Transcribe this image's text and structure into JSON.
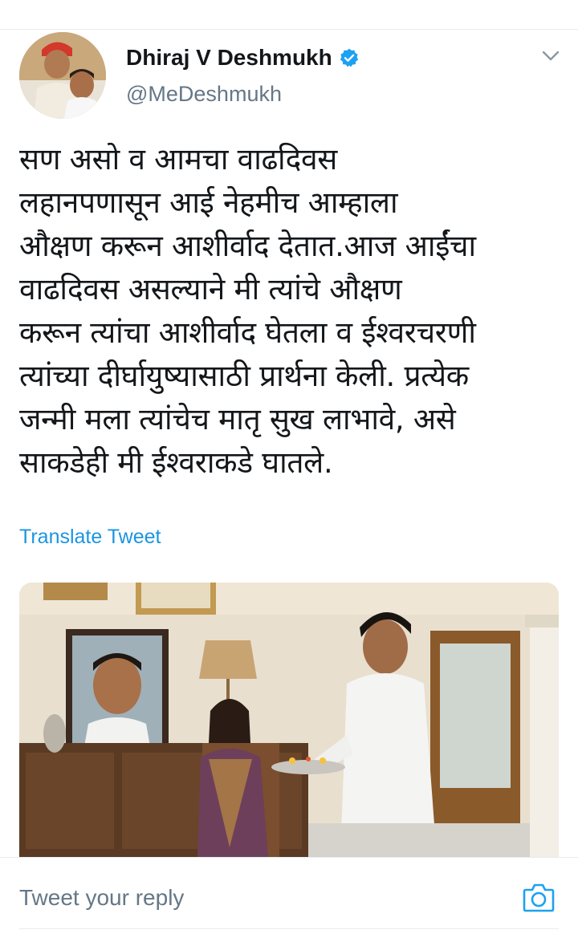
{
  "tweet": {
    "author": {
      "display_name": "Dhiraj V Deshmukh",
      "handle": "@MeDeshmukh",
      "verified": true
    },
    "text": "सण असो व आमचा वाढदिवस\nलहानपणासून आई नेहमीच आम्हाला\nऔक्षण करून आशीर्वाद देतात.आज आईंचा\nवाढदिवस असल्याने मी त्यांचे औक्षण\nकरून त्यांचा आशीर्वाद घेतला व ईश्वरचरणी\nत्यांच्या दीर्घायुष्यासाठी प्रार्थना केली. प्रत्येक\nजन्मी मला त्यांचेच मातृ सुख लाभावे, असे\nसाकडेही मी ईश्वराकडे घातले.",
    "translate_label": "Translate Tweet",
    "media": {
      "type": "video-thumbnail"
    }
  },
  "reply": {
    "placeholder": "Tweet your reply"
  },
  "icons": {
    "verified": "verified-badge-icon",
    "more": "chevron-down-icon",
    "camera": "camera-icon"
  },
  "colors": {
    "link": "#1b95e0",
    "secondary_text": "#657786",
    "primary_text": "#14171a",
    "divider": "#e6ecf0",
    "verified_badge": "#1da1f2"
  }
}
